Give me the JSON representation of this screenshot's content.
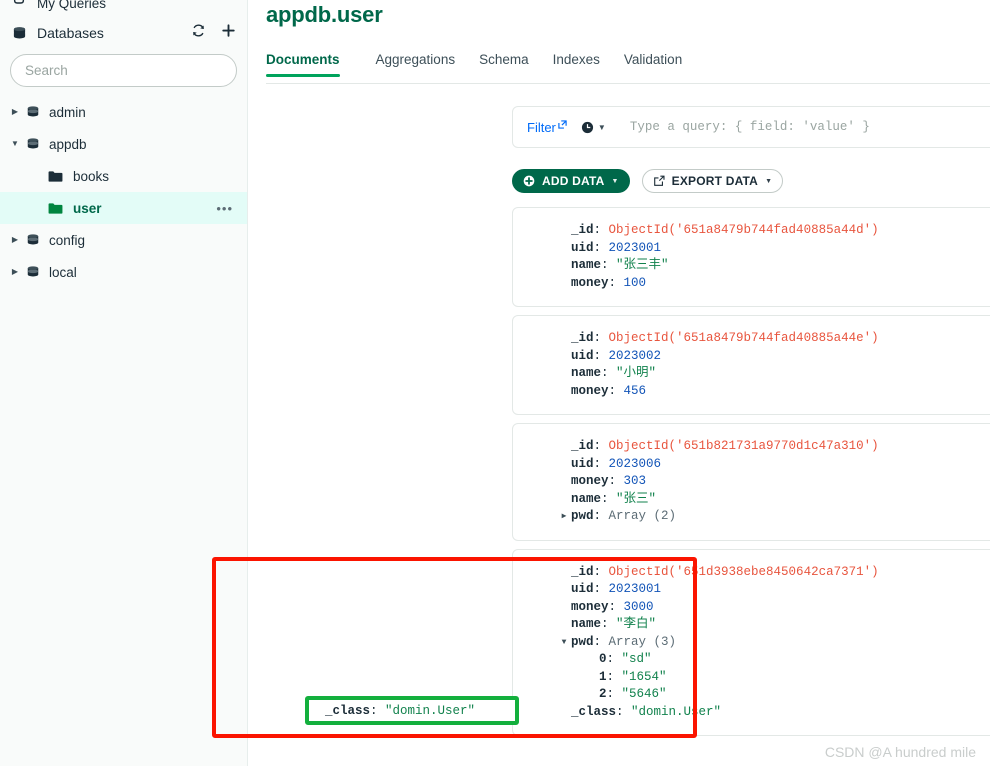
{
  "sidebar": {
    "my_queries": "My Queries",
    "databases_label": "Databases",
    "refresh_icon": "refresh-icon",
    "add_icon": "plus-icon",
    "search_placeholder": "Search",
    "search_value": "",
    "tree": [
      {
        "label": "admin",
        "type": "database",
        "expanded": false,
        "selected": false
      },
      {
        "label": "appdb",
        "type": "database",
        "expanded": true,
        "selected": false
      },
      {
        "label": "books",
        "type": "collection",
        "expanded": false,
        "selected": false
      },
      {
        "label": "user",
        "type": "collection",
        "expanded": false,
        "selected": true,
        "menu": "•••"
      },
      {
        "label": "config",
        "type": "database",
        "expanded": false,
        "selected": false
      },
      {
        "label": "local",
        "type": "database",
        "expanded": false,
        "selected": false
      }
    ]
  },
  "main": {
    "namespace_title": "appdb.user",
    "tabs": [
      {
        "label": "Documents",
        "active": true
      },
      {
        "label": "Aggregations",
        "active": false
      },
      {
        "label": "Schema",
        "active": false
      },
      {
        "label": "Indexes",
        "active": false
      },
      {
        "label": "Validation",
        "active": false
      }
    ],
    "querybar": {
      "filter_label": "Filter",
      "external_link_icon": "external-link-icon",
      "history_icon": "history-clock-icon",
      "history_caret": "▼",
      "query_placeholder": "Type a query: { field: 'value' }",
      "query_value": ""
    },
    "toolbar": {
      "add_data_label": "ADD DATA",
      "add_data_icon": "plus-circle-icon",
      "add_data_caret": "▼",
      "export_data_label": "EXPORT DATA",
      "export_data_icon": "export-icon",
      "export_data_caret": "▼"
    }
  },
  "documents": [
    {
      "fields": [
        {
          "key": "_id",
          "value": "ObjectId('651a8479b744fad40885a44d')",
          "vtype": "objectid",
          "indent": 0
        },
        {
          "key": "uid",
          "value": "2023001",
          "vtype": "number",
          "indent": 0
        },
        {
          "key": "name",
          "value": "\"张三丰\"",
          "vtype": "string",
          "indent": 0
        },
        {
          "key": "money",
          "value": "100",
          "vtype": "number",
          "indent": 0
        }
      ]
    },
    {
      "fields": [
        {
          "key": "_id",
          "value": "ObjectId('651a8479b744fad40885a44e')",
          "vtype": "objectid",
          "indent": 0
        },
        {
          "key": "uid",
          "value": "2023002",
          "vtype": "number",
          "indent": 0
        },
        {
          "key": "name",
          "value": "\"小明\"",
          "vtype": "string",
          "indent": 0
        },
        {
          "key": "money",
          "value": "456",
          "vtype": "number",
          "indent": 0
        }
      ]
    },
    {
      "fields": [
        {
          "key": "_id",
          "value": "ObjectId('651b821731a9770d1c47a310')",
          "vtype": "objectid",
          "indent": 0
        },
        {
          "key": "uid",
          "value": "2023006",
          "vtype": "number",
          "indent": 0
        },
        {
          "key": "money",
          "value": "303",
          "vtype": "number",
          "indent": 0
        },
        {
          "key": "name",
          "value": "\"张三\"",
          "vtype": "string",
          "indent": 0
        },
        {
          "key": "pwd",
          "value": "Array (2)",
          "vtype": "meta",
          "indent": 0,
          "expander": "▶"
        }
      ]
    },
    {
      "fields": [
        {
          "key": "_id",
          "value": "ObjectId('651d3938ebe8450642ca7371')",
          "vtype": "objectid",
          "indent": 0
        },
        {
          "key": "uid",
          "value": "2023001",
          "vtype": "number",
          "indent": 0
        },
        {
          "key": "money",
          "value": "3000",
          "vtype": "number",
          "indent": 0
        },
        {
          "key": "name",
          "value": "\"李白\"",
          "vtype": "string",
          "indent": 0
        },
        {
          "key": "pwd",
          "value": "Array (3)",
          "vtype": "meta",
          "indent": 0,
          "expander": "▼"
        },
        {
          "key": "0",
          "value": "\"sd\"",
          "vtype": "string",
          "indent": 1
        },
        {
          "key": "1",
          "value": "\"1654\"",
          "vtype": "string",
          "indent": 1
        },
        {
          "key": "2",
          "value": "\"5646\"",
          "vtype": "string",
          "indent": 1
        },
        {
          "key": "_class",
          "value": "\"domin.User\"",
          "vtype": "string",
          "indent": 0
        }
      ]
    }
  ],
  "annotations": {
    "red_box": {
      "color": "#fb1400",
      "name": "red-highlight-box"
    },
    "green_box": {
      "color": "#13af3d",
      "name": "green-highlight-box",
      "key": "_class",
      "value": "\"domin.User\""
    }
  },
  "watermark": "CSDN @A hundred mile"
}
